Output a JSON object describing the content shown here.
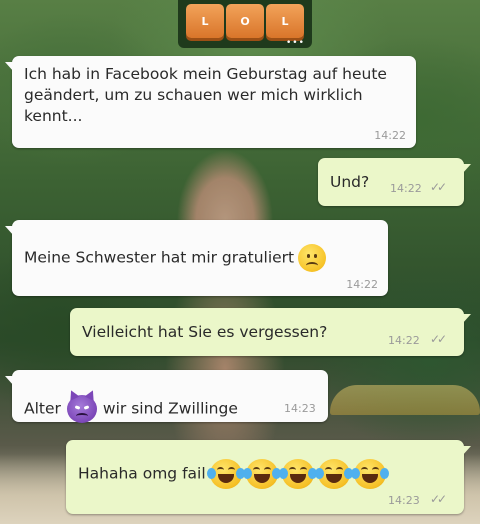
{
  "logo": {
    "keys": [
      "L",
      "O",
      "L"
    ],
    "dots": "•••"
  },
  "messages": [
    {
      "direction": "incoming",
      "text": "Ich hab in Facebook mein Geburstag auf heute geändert, um zu schauen wer mich wirklich kennt...",
      "time": "14:22"
    },
    {
      "direction": "outgoing",
      "text": "Und?",
      "time": "14:22",
      "status": "read-ticks"
    },
    {
      "direction": "incoming",
      "text": "Meine Schwester hat mir gratuliert",
      "emoji": "sad-face-emoji",
      "time": "14:22"
    },
    {
      "direction": "outgoing",
      "text": "Vielleicht hat Sie es vergessen?",
      "time": "14:22",
      "status": "read-ticks"
    },
    {
      "direction": "incoming",
      "text_before": "Alter",
      "emoji": "angry-devil-emoji",
      "text_after": "wir sind Zwillinge",
      "time": "14:23"
    },
    {
      "direction": "outgoing",
      "text": "Hahaha omg fail",
      "emoji": "laughing-tears-emoji",
      "emoji_count": 5,
      "time": "14:23",
      "status": "read-ticks"
    }
  ],
  "ticks_glyph": "✓✓"
}
